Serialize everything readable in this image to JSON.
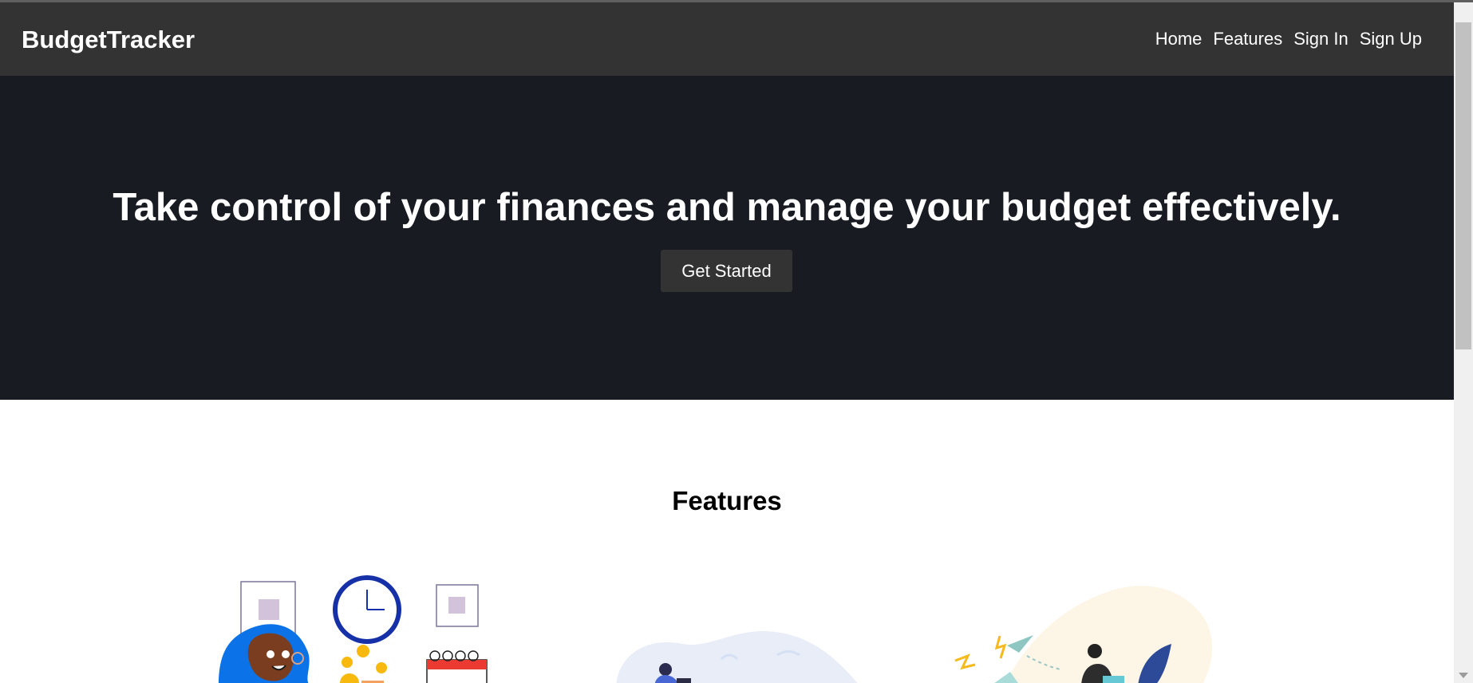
{
  "site": {
    "brand": "BudgetTracker"
  },
  "nav": {
    "items": [
      {
        "label": "Home"
      },
      {
        "label": "Features"
      },
      {
        "label": "Sign In"
      },
      {
        "label": "Sign Up"
      }
    ]
  },
  "hero": {
    "title": "Take control of your finances and manage your budget effectively.",
    "button_label": "Get Started"
  },
  "features": {
    "title": "Features",
    "illustrations": [
      {
        "icon": "budget-planning-illustration"
      },
      {
        "icon": "laptop-user-illustration"
      },
      {
        "icon": "growth-workspace-illustration"
      }
    ]
  },
  "colors": {
    "navbar": "#333333",
    "hero": "#181b22",
    "button": "#333333",
    "text_light": "#ffffff",
    "text_dark": "#000000"
  }
}
